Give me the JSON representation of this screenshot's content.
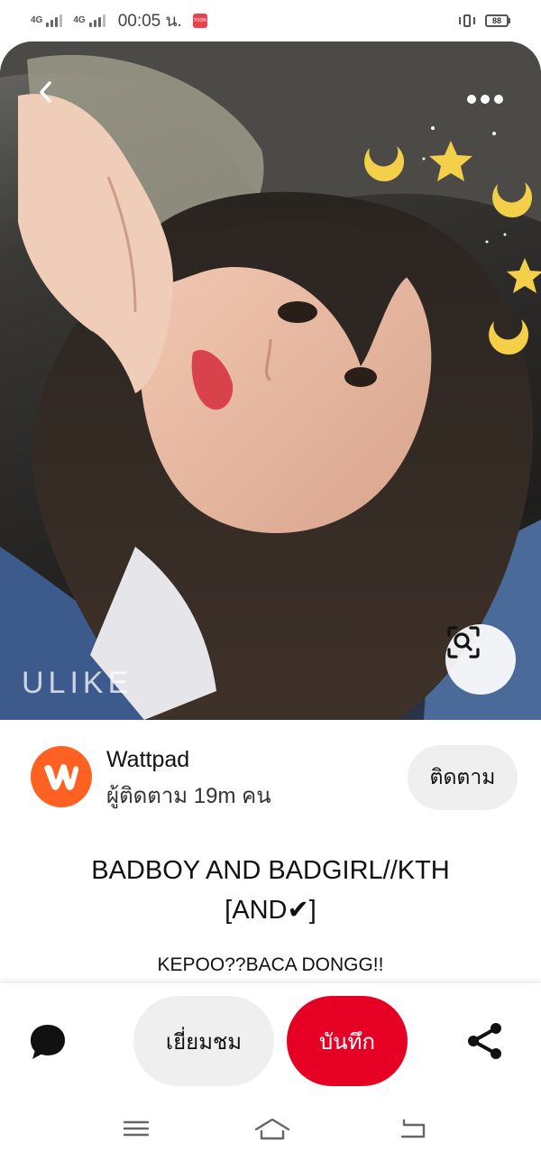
{
  "status_bar": {
    "network_1": "4G",
    "network_2": "4G",
    "time": "00:05 น.",
    "app_badge": "TOON",
    "battery": "88"
  },
  "hero": {
    "watermark": "ULIKE"
  },
  "profile": {
    "name": "Wattpad",
    "followers": "ผู้ติดตาม 19m คน",
    "follow_label": "ติดตาม",
    "brand_color": "#ff6122"
  },
  "pin": {
    "title": "BADBOY AND BADGIRL//KTH [AND✔]",
    "description": "KEPOO??BACA DONGG!!"
  },
  "actions": {
    "visit_label": "เยี่ยมชม",
    "save_label": "บันทึก",
    "save_color": "#e60023"
  },
  "icons": {
    "back": "chevron-left-icon",
    "more": "more-horizontal-icon",
    "visual_search": "visual-search-icon",
    "comment": "comment-bubble-icon",
    "share": "share-icon",
    "nav_menu": "menu-icon",
    "nav_home": "home-icon",
    "nav_back": "back-icon"
  }
}
